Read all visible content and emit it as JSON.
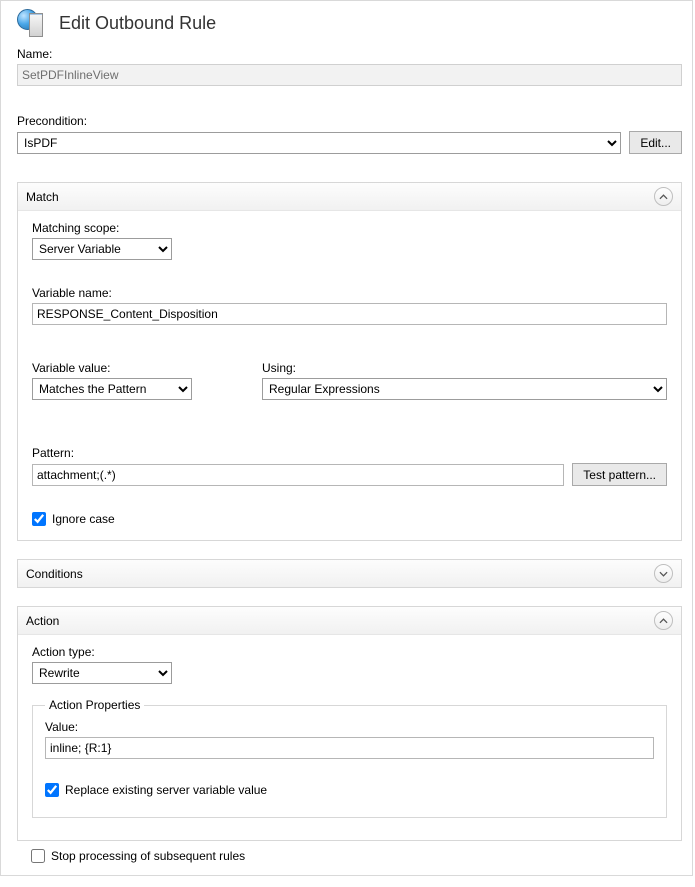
{
  "header": {
    "title": "Edit Outbound Rule"
  },
  "name": {
    "label": "Name:",
    "value": "SetPDFInlineView"
  },
  "precondition": {
    "label": "Precondition:",
    "selected": "IsPDF",
    "options": [
      "IsPDF"
    ],
    "edit_label": "Edit..."
  },
  "match": {
    "title": "Match",
    "scope_label": "Matching scope:",
    "scope_selected": "Server Variable",
    "scope_options": [
      "Server Variable"
    ],
    "varname_label": "Variable name:",
    "varname_value": "RESPONSE_Content_Disposition",
    "varvalue_label": "Variable value:",
    "varvalue_selected": "Matches the Pattern",
    "varvalue_options": [
      "Matches the Pattern"
    ],
    "using_label": "Using:",
    "using_selected": "Regular Expressions",
    "using_options": [
      "Regular Expressions"
    ],
    "pattern_label": "Pattern:",
    "pattern_value": "attachment;(.*)",
    "test_label": "Test pattern...",
    "ignore_case_label": "Ignore case",
    "ignore_case_checked": true
  },
  "conditions": {
    "title": "Conditions",
    "expanded": false
  },
  "action": {
    "title": "Action",
    "type_label": "Action type:",
    "type_selected": "Rewrite",
    "type_options": [
      "Rewrite"
    ],
    "props_title": "Action Properties",
    "value_label": "Value:",
    "value": "inline; {R:1}",
    "replace_label": "Replace existing server variable value",
    "replace_checked": true
  },
  "stop": {
    "label": "Stop processing of subsequent rules",
    "checked": false
  }
}
